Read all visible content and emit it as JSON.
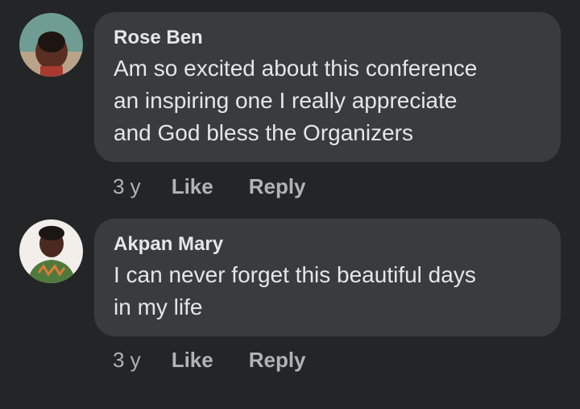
{
  "comments": [
    {
      "author": "Rose Ben",
      "text": "Am so excited about this conference\nan inspiring one I really appreciate\nand God bless the Organizers",
      "time": "3 y",
      "like_label": "Like",
      "reply_label": "Reply",
      "avatar_icon": "profile-photo"
    },
    {
      "author": "Akpan Mary",
      "text": "I can never forget this beautiful days\nin my life",
      "time": "3 y",
      "like_label": "Like",
      "reply_label": "Reply",
      "avatar_icon": "profile-photo"
    }
  ],
  "colors": {
    "background": "#242526",
    "bubble": "#3a3b3c",
    "text_primary": "#e4e6eb",
    "text_secondary": "#b0b3b8"
  }
}
